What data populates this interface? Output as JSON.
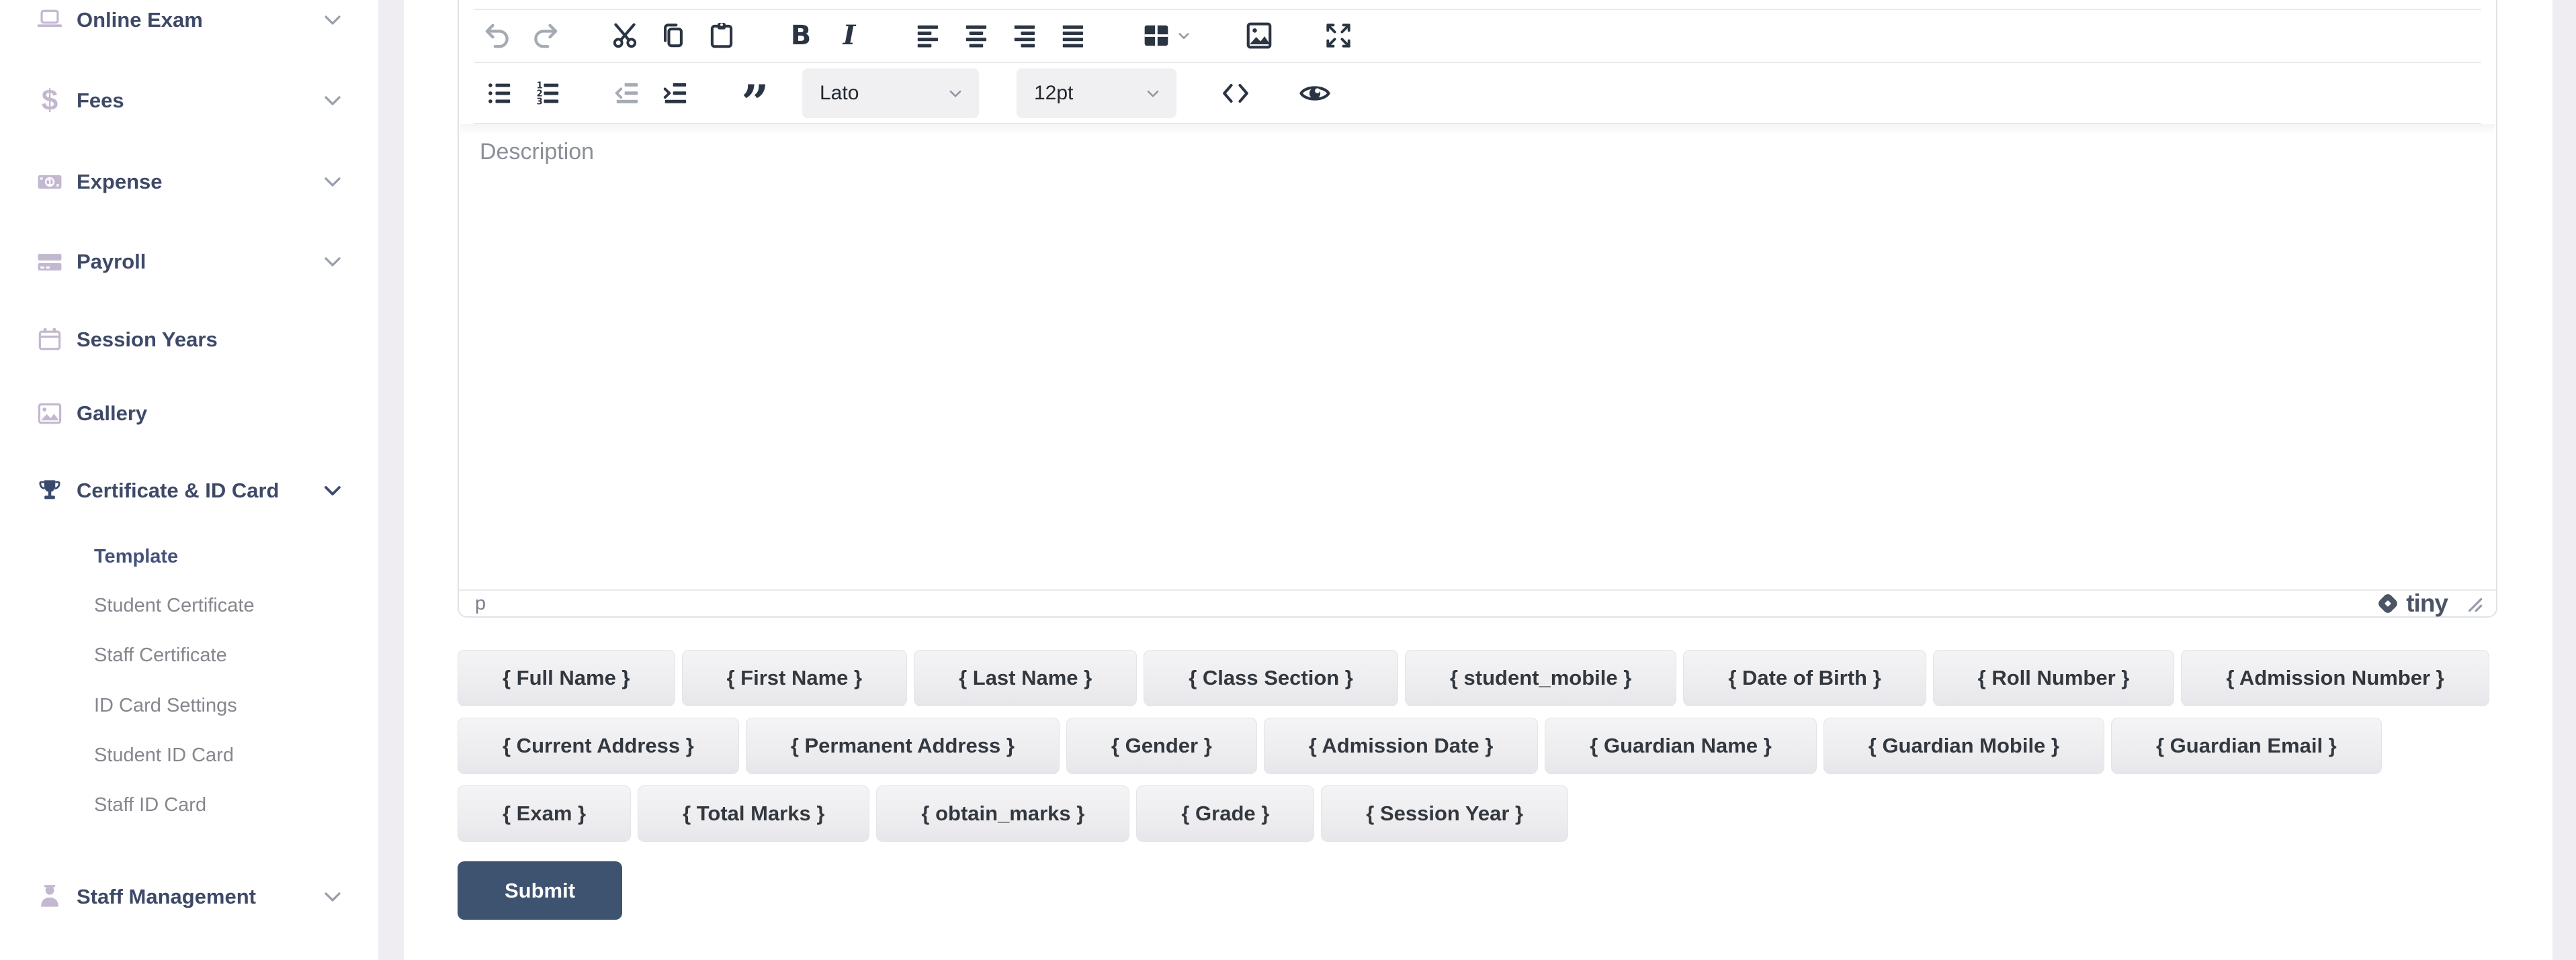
{
  "colors": {
    "accent": "#3e5370",
    "sidebar_icon": "#c3b8d0",
    "sidebar_text": "#3e4967",
    "sidebar_sub_text": "#85878e",
    "active_item": "#3a4a6e",
    "toolbar_icon": "#2b3442",
    "toolbar_icon_disabled": "#a5abb3",
    "strip_bg": "#efedf2",
    "tag_text": "#33383f",
    "editor_border": "#e1e2e6"
  },
  "sidebar": {
    "items": [
      {
        "label": "Online Exam",
        "icon": "laptop-icon",
        "has_chevron": true,
        "active": false
      },
      {
        "label": "Fees",
        "icon": "dollar-icon",
        "has_chevron": true,
        "active": false
      },
      {
        "label": "Expense",
        "icon": "money-bill-icon",
        "has_chevron": true,
        "active": false
      },
      {
        "label": "Payroll",
        "icon": "credit-card-icon",
        "has_chevron": true,
        "active": false
      },
      {
        "label": "Session Years",
        "icon": "calendar-icon",
        "has_chevron": false,
        "active": false
      },
      {
        "label": "Gallery",
        "icon": "gallery-icon",
        "has_chevron": false,
        "active": false
      },
      {
        "label": "Certificate & ID Card",
        "icon": "trophy-icon",
        "has_chevron": true,
        "active": true,
        "children": [
          {
            "label": "Template",
            "active": true
          },
          {
            "label": "Student Certificate",
            "active": false
          },
          {
            "label": "Staff Certificate",
            "active": false
          },
          {
            "label": "ID Card Settings",
            "active": false
          },
          {
            "label": "Student ID Card",
            "active": false
          },
          {
            "label": "Staff ID Card",
            "active": false
          }
        ]
      },
      {
        "label": "Staff Management",
        "icon": "staff-icon",
        "has_chevron": true,
        "active": false
      }
    ]
  },
  "editor": {
    "toolbar_row1": [
      "undo",
      "redo",
      "cut",
      "copy",
      "paste",
      "bold",
      "italic",
      "align-left",
      "align-center",
      "align-right",
      "justify",
      "table",
      "image",
      "fullscreen"
    ],
    "toolbar_row2": [
      "bullet-list",
      "numbered-list",
      "outdent",
      "indent",
      "blockquote",
      "font-family-select",
      "font-size-select",
      "code",
      "preview"
    ],
    "disabled_buttons": [
      "undo",
      "redo",
      "outdent"
    ],
    "font_family": "Lato",
    "font_size": "12pt",
    "placeholder": "Description",
    "statusbar": {
      "element_path": "p",
      "brand": "tiny"
    }
  },
  "tags": {
    "rows": [
      {
        "items": [
          "{ Full Name }",
          "{ First Name }",
          "{ Last Name }",
          "{ Class Section }",
          "{ student_mobile }",
          "{ Date of Birth }",
          "{ Roll Number }",
          "{ Admission Number }"
        ]
      },
      {
        "items": [
          "{ Current Address }",
          "{ Permanent Address }",
          "{ Gender }",
          "{ Admission Date }",
          "{ Guardian Name }",
          "{ Guardian Mobile }",
          "{ Guardian Email }"
        ]
      },
      {
        "items": [
          "{ Exam }",
          "{ Total Marks }",
          "{ obtain_marks }",
          "{ Grade }",
          "{ Session Year }"
        ]
      }
    ]
  },
  "actions": {
    "submit_label": "Submit"
  }
}
